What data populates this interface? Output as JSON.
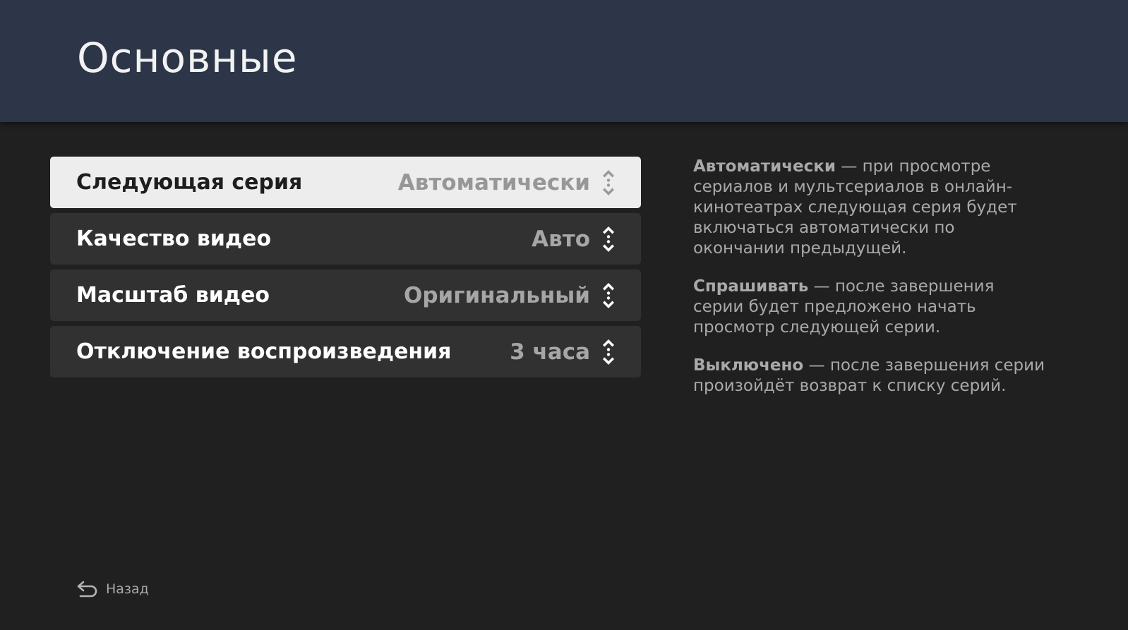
{
  "header": {
    "title": "Основные"
  },
  "settings": [
    {
      "label": "Следующая серия",
      "value": "Автоматически",
      "selected": true
    },
    {
      "label": "Качество видео",
      "value": "Авто",
      "selected": false
    },
    {
      "label": "Масштаб видео",
      "value": "Оригинальный",
      "selected": false
    },
    {
      "label": "Отключение воспроизведения",
      "value": "3 часа",
      "selected": false
    }
  ],
  "help": [
    {
      "term": "Автоматически",
      "text": " — при просмотре сериалов и мультсериалов в онлайн-кинотеатрах следующая серия будет включаться автоматически по окончании предыдущей."
    },
    {
      "term": "Спрашивать",
      "text": " — после завершения серии будет предложено начать просмотр следующей серии."
    },
    {
      "term": "Выключено",
      "text": " — после завершения серии произойдёт возврат к списку серий."
    }
  ],
  "footer": {
    "back_label": "Назад",
    "back_icon": "back-arrow-icon"
  },
  "colors": {
    "header_bg": "#2c3648",
    "page_bg": "#202020",
    "row_bg": "#313131",
    "row_selected_bg": "#ededed"
  },
  "icons": {
    "stepper": "up-down-stepper-icon"
  }
}
